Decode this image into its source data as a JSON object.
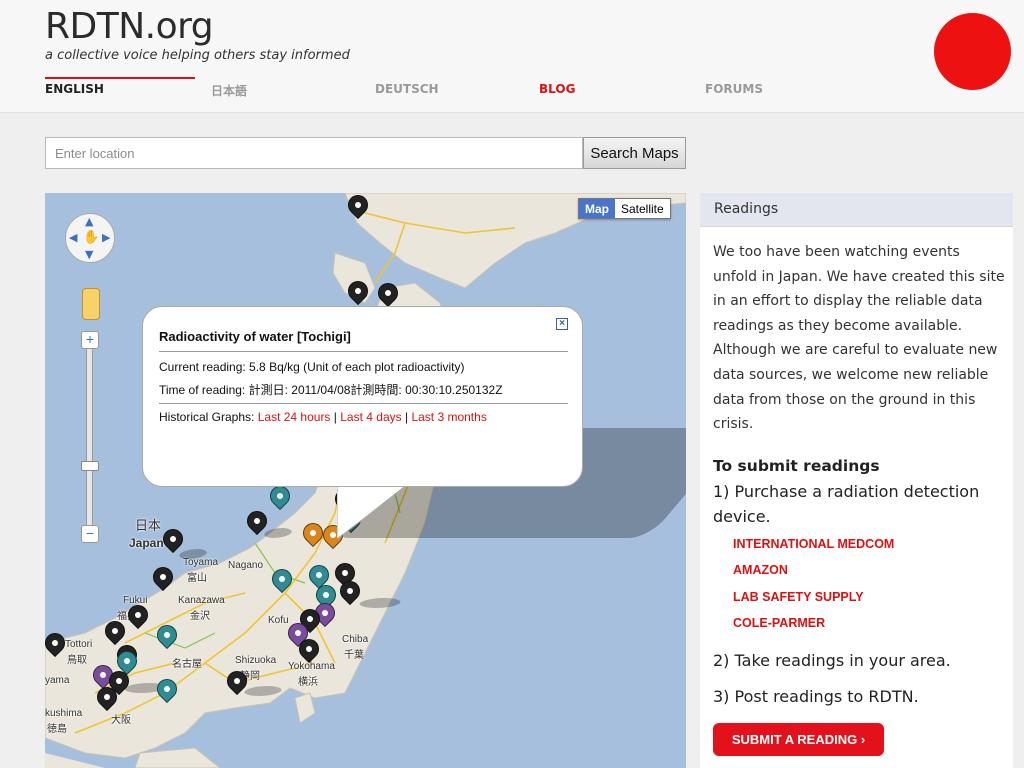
{
  "site": {
    "logo": "RDTN.org",
    "tagline": "a collective voice helping others stay informed",
    "colors": {
      "accent": "#dd1111",
      "sun": "#ee1111"
    }
  },
  "nav": {
    "items": [
      {
        "label": "ENGLISH"
      },
      {
        "label": "日本語"
      },
      {
        "label": "DEUTSCH"
      },
      {
        "label": "BLOG"
      },
      {
        "label": "FORUMS"
      }
    ]
  },
  "search": {
    "placeholder": "Enter location",
    "button_label": "Search Maps"
  },
  "map": {
    "type_map": "Map",
    "type_satellite": "Satellite",
    "places": {
      "japan": "日本",
      "japan_en": "Japan",
      "toyama": "Toyama",
      "toyama_jp": "富山",
      "nagano": "Nagano",
      "kanazawa": "Kanazawa",
      "kanazawa_jp": "金沢",
      "fukui": "Fukui",
      "fukui_jp": "福井",
      "tottori": "Tottori",
      "tottori_jp": "鳥取",
      "kofu": "Kofu",
      "chiba": "Chiba",
      "chiba_jp": "千葉",
      "shizuoka": "Shizuoka",
      "shizuoka_jp": "静岡",
      "yokohama": "Yokohama",
      "yokohama_jp": "横浜",
      "nagoya_jp": "名古屋",
      "osaka_jp": "大阪",
      "kushima": "kushima",
      "ama": "yama",
      "pref": "徳島"
    },
    "popup": {
      "title": "Radioactivity of water [Tochigi]",
      "current_reading": "Current reading: 5.8 Bq/kg (Unit of each plot radioactivity)",
      "time_of_reading": "Time of reading: 計測日: 2011/04/08計測時間: 00:30:10.250132Z",
      "historical_label": "Historical Graphs:",
      "link_24h": "Last 24 hours",
      "link_4d": "Last 4 days",
      "link_3m": "Last 3 months",
      "separator": "|"
    }
  },
  "readings": {
    "header": "Readings",
    "intro": "We too have been watching events unfold in Japan. We have created this site in an effort to display the reliable data readings as they become available. Although we are careful to evaluate new data sources, we welcome new reliable data from those on the ground in this crisis.",
    "submit_heading": "To submit readings",
    "step1": "1) Purchase a radiation detection device.",
    "vendors": [
      "INTERNATIONAL MEDCOM",
      "AMAZON",
      "LAB SAFETY SUPPLY",
      "COLE-PARMER"
    ],
    "step2": "2) Take readings in your area.",
    "step3": "3) Post readings to RDTN.",
    "submit_button": "SUBMIT A READING ›"
  }
}
